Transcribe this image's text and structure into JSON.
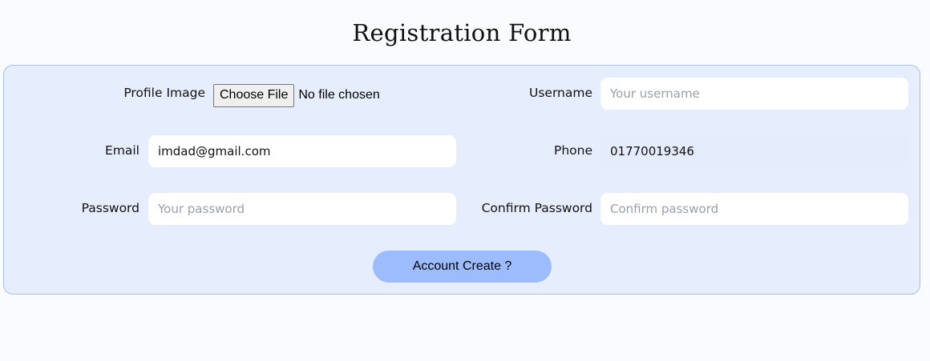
{
  "page": {
    "title": "Registration Form"
  },
  "form": {
    "profile_image": {
      "label": "Profile Image",
      "button_label": "Choose File",
      "status": "No file chosen"
    },
    "username": {
      "label": "Username",
      "value": "",
      "placeholder": "Your username"
    },
    "email": {
      "label": "Email",
      "value": "imdad@gmail.com",
      "placeholder": ""
    },
    "phone": {
      "label": "Phone",
      "value": "01770019346",
      "placeholder": ""
    },
    "password": {
      "label": "Password",
      "value": "",
      "placeholder": "Your password"
    },
    "confirm_password": {
      "label": "Confirm Password",
      "value": "",
      "placeholder": "Confirm password"
    },
    "submit_label": "Account Create ?"
  },
  "colors": {
    "page_background": "#f9fbff",
    "card_background": "#e6edfc",
    "card_border": "#a9c1ea",
    "button_background": "#9cbcff"
  }
}
